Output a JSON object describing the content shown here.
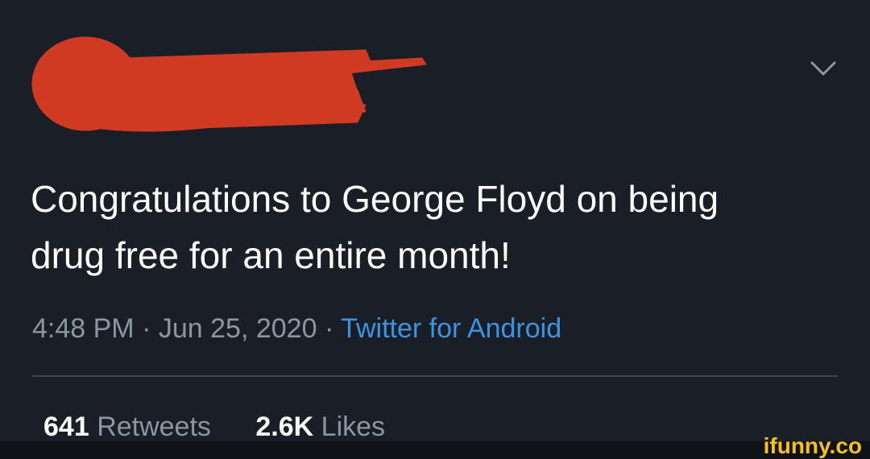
{
  "tweet": {
    "text_line1": "Congratulations to George Floyd on being",
    "text_line2": "drug free for an entire month!",
    "time": "4:48 PM",
    "separator": "·",
    "date": "Jun 25, 2020",
    "source": "Twitter for Android",
    "retweets_count": "641",
    "retweets_label": "Retweets",
    "likes_count": "2.6K",
    "likes_label": "Likes"
  },
  "icons": {
    "menu": "chevron-down-icon",
    "redaction": "red-scribble-redaction"
  },
  "watermark": "ifunny.co",
  "colors": {
    "background": "#1a1f27",
    "text": "#ffffff",
    "muted": "#8a97a3",
    "link": "#3b93e2",
    "redaction": "#d03a22",
    "watermark": "#f4c21a"
  }
}
